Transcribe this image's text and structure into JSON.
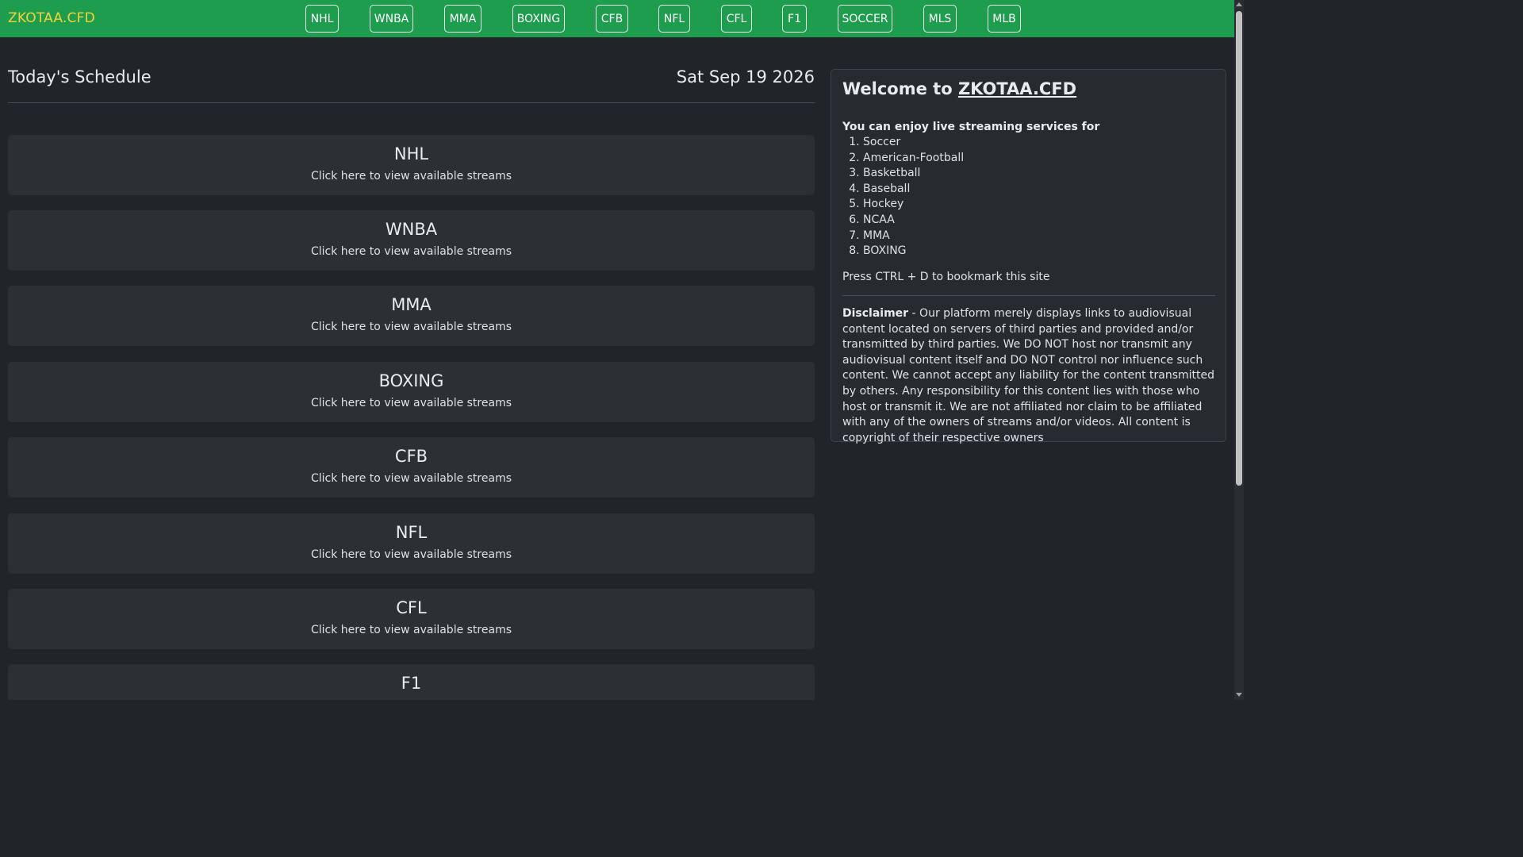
{
  "brand": "ZKOTAA.CFD",
  "nav": [
    "NHL",
    "WNBA",
    "MMA",
    "BOXING",
    "CFB",
    "NFL",
    "CFL",
    "F1",
    "SOCCER",
    "MLS",
    "MLB"
  ],
  "schedule": {
    "title": "Today's Schedule",
    "date": "Sat Sep 19 2026",
    "cards": [
      {
        "title": "NHL",
        "subtitle": "Click here to view available streams"
      },
      {
        "title": "WNBA",
        "subtitle": "Click here to view available streams"
      },
      {
        "title": "MMA",
        "subtitle": "Click here to view available streams"
      },
      {
        "title": "BOXING",
        "subtitle": "Click here to view available streams"
      },
      {
        "title": "CFB",
        "subtitle": "Click here to view available streams"
      },
      {
        "title": "NFL",
        "subtitle": "Click here to view available streams"
      },
      {
        "title": "CFL",
        "subtitle": "Click here to view available streams"
      },
      {
        "title": "F1",
        "subtitle": ""
      }
    ]
  },
  "sidebar": {
    "welcome_prefix": "Welcome to",
    "welcome_link": "ZKOTAA.CFD",
    "enjoy_heading": "You can enjoy live streaming services for",
    "sports": [
      "Soccer",
      "American-Football",
      "Basketball",
      "Baseball",
      "Hockey",
      "NCAA",
      "MMA",
      "BOXING"
    ],
    "bookmark_text": "Press CTRL + D to bookmark this site",
    "disclaimer_label": "Disclaimer",
    "disclaimer_text": " - Our platform merely displays links to audiovisual content located on servers of third parties and provided and/or transmitted by third parties. We DO NOT host nor transmit any audiovisual content itself and DO NOT control nor influence such content. We cannot accept any liability for the content transmitted by others. Any responsibility for this content lies with those who host or transmit it. We are not affiliated nor claim to be affiliated with any of the owners of streams and/or videos. All content is copyright of their respective owners"
  },
  "colors": {
    "navbar": "#1f9d4f",
    "brand": "#f3d33a",
    "background": "#212529",
    "card": "#2b3035"
  }
}
